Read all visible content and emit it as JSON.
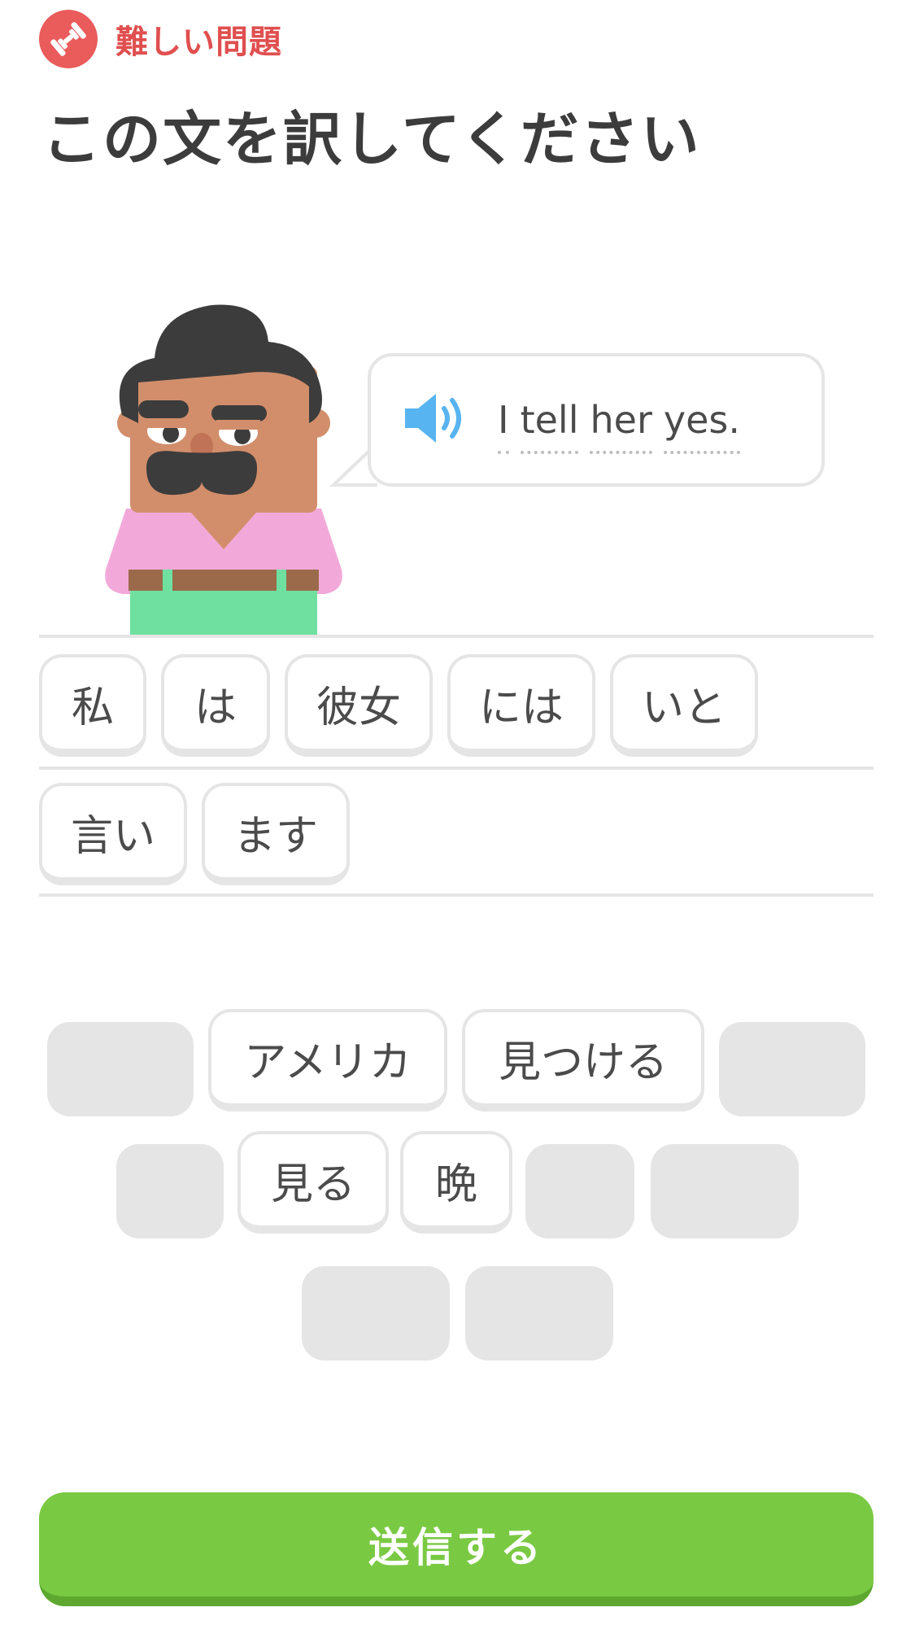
{
  "badge": {
    "label": "難しい問題",
    "icon": "dumbbell-icon",
    "color": "#ea5b5b"
  },
  "title": "この文を訳してください",
  "prompt": {
    "speaker_icon": "speaker-icon",
    "words": [
      "I",
      "tell",
      "her",
      "yes."
    ]
  },
  "answer": {
    "row1": [
      "私",
      "は",
      "彼女",
      "には",
      "いと"
    ],
    "row2": [
      "言い",
      "ます"
    ]
  },
  "bank": {
    "row1": [
      "アメリカ",
      "見つける"
    ],
    "row2": [
      "見る",
      "晩"
    ]
  },
  "submit_label": "送信する",
  "colors": {
    "accent_green": "#7ac943",
    "accent_red": "#ea5b5b",
    "speaker_blue": "#58b4f0"
  }
}
